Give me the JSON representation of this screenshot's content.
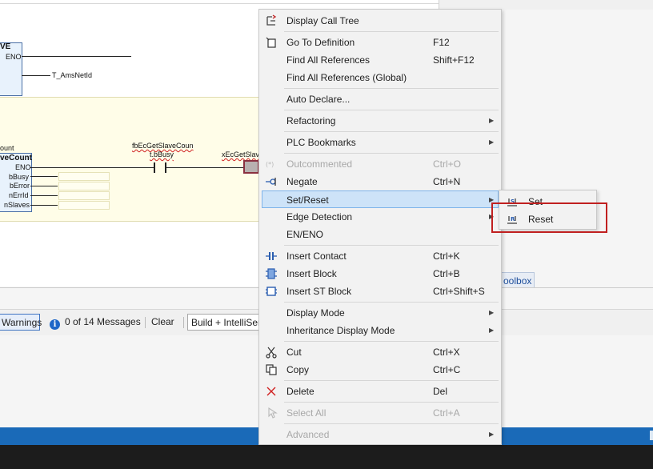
{
  "editor": {
    "fb1_title": "VE",
    "fb1_pin_eno": "ENO",
    "fb1_output_var": "T_AmsNetId",
    "fb2_above_title": "ount",
    "fb2_title": "veCount",
    "fb2_pins": [
      "ENO",
      "bBusy",
      "bError",
      "nErrId",
      "nSlaves"
    ],
    "contact_instance": "fbEcGetSlaveCoun",
    "contact_var": "t.bBusy",
    "coil_var": "xEcGetSlave"
  },
  "context_menu": {
    "items": [
      {
        "icon": "call-tree-icon",
        "label": "Display Call Tree",
        "shortcut": "",
        "submenu": false,
        "disabled": false
      },
      {
        "icon": "go-to-definition-icon",
        "label": "Go To Definition",
        "shortcut": "F12",
        "submenu": false,
        "disabled": false
      },
      {
        "icon": "",
        "label": "Find All References",
        "shortcut": "Shift+F12",
        "submenu": false,
        "disabled": false
      },
      {
        "icon": "",
        "label": "Find All References (Global)",
        "shortcut": "",
        "submenu": false,
        "disabled": false
      },
      {
        "icon": "",
        "label": "Auto Declare...",
        "shortcut": "",
        "submenu": false,
        "disabled": false
      },
      {
        "icon": "",
        "label": "Refactoring",
        "shortcut": "",
        "submenu": true,
        "disabled": false
      },
      {
        "icon": "",
        "label": "PLC Bookmarks",
        "shortcut": "",
        "submenu": true,
        "disabled": false
      },
      {
        "icon": "comment-icon",
        "label": "Outcommented",
        "shortcut": "Ctrl+O",
        "submenu": false,
        "disabled": true
      },
      {
        "icon": "negate-icon",
        "label": "Negate",
        "shortcut": "Ctrl+N",
        "submenu": false,
        "disabled": false
      },
      {
        "icon": "",
        "label": "Set/Reset",
        "shortcut": "",
        "submenu": true,
        "disabled": false,
        "highlighted": true
      },
      {
        "icon": "",
        "label": "Edge Detection",
        "shortcut": "",
        "submenu": true,
        "disabled": false
      },
      {
        "icon": "",
        "label": "EN/ENO",
        "shortcut": "",
        "submenu": false,
        "disabled": false
      },
      {
        "icon": "insert-contact-icon",
        "label": "Insert Contact",
        "shortcut": "Ctrl+K",
        "submenu": false,
        "disabled": false
      },
      {
        "icon": "insert-block-icon",
        "label": "Insert Block",
        "shortcut": "Ctrl+B",
        "submenu": false,
        "disabled": false
      },
      {
        "icon": "insert-st-block-icon",
        "label": "Insert ST Block",
        "shortcut": "Ctrl+Shift+S",
        "submenu": false,
        "disabled": false
      },
      {
        "icon": "",
        "label": "Display Mode",
        "shortcut": "",
        "submenu": true,
        "disabled": false
      },
      {
        "icon": "",
        "label": "Inheritance Display Mode",
        "shortcut": "",
        "submenu": true,
        "disabled": false
      },
      {
        "icon": "cut-icon",
        "label": "Cut",
        "shortcut": "Ctrl+X",
        "submenu": false,
        "disabled": false
      },
      {
        "icon": "copy-icon",
        "label": "Copy",
        "shortcut": "Ctrl+C",
        "submenu": false,
        "disabled": false
      },
      {
        "icon": "delete-icon",
        "label": "Delete",
        "shortcut": "Del",
        "submenu": false,
        "disabled": false
      },
      {
        "icon": "select-all-icon",
        "label": "Select All",
        "shortcut": "Ctrl+A",
        "submenu": false,
        "disabled": true
      },
      {
        "icon": "",
        "label": "Advanced",
        "shortcut": "",
        "submenu": true,
        "disabled": true
      }
    ]
  },
  "submenu": {
    "items": [
      {
        "icon": "set-coil-icon",
        "glyph": "S",
        "label": "Set"
      },
      {
        "icon": "reset-coil-icon",
        "glyph": "R",
        "label": "Reset"
      }
    ]
  },
  "error_list": {
    "warnings_label": "Warnings",
    "messages_label": "0 of 14 Messages",
    "clear_label": "Clear",
    "build_filter_value": "Build + IntelliSense"
  },
  "toolbox_tab_label": "oolbox"
}
